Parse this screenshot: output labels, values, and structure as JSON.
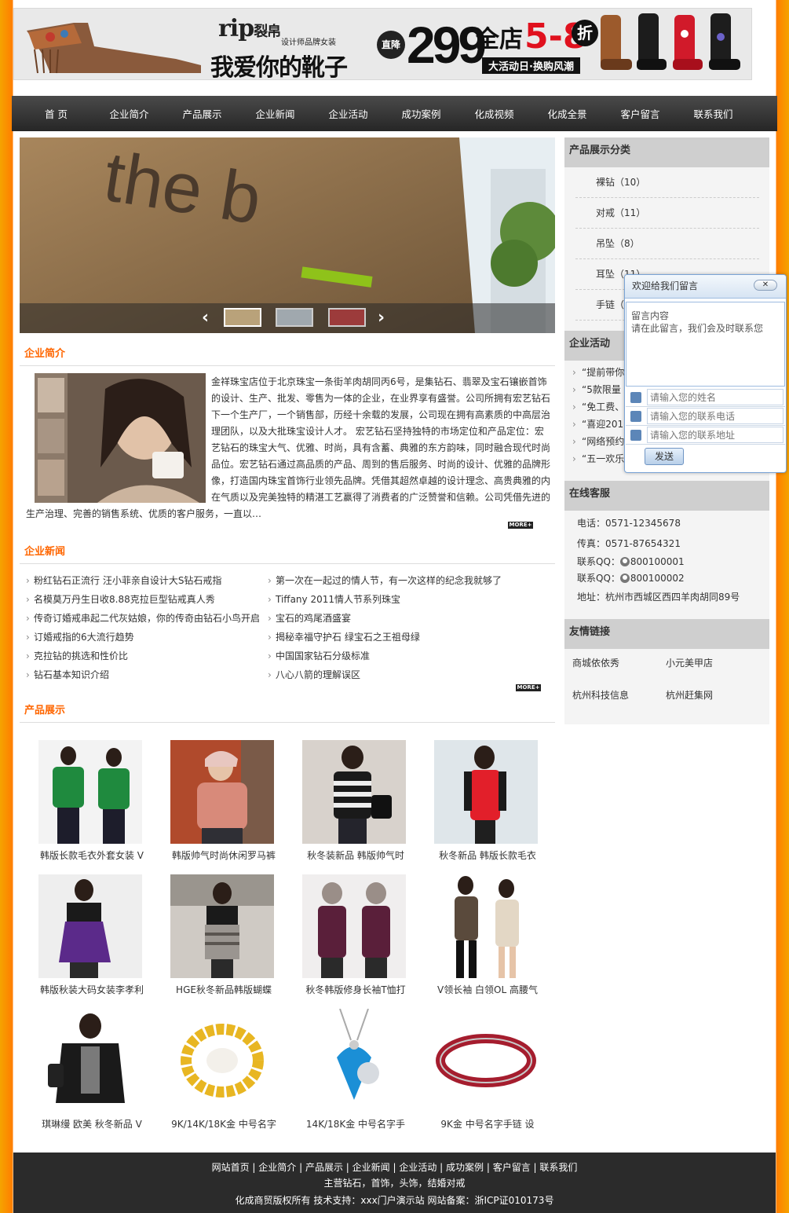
{
  "banner": {
    "logo": "rip",
    "logo_cn": "裂帛",
    "logo_sub": "设计师品牌女装",
    "slogan": "我爱你的靴子",
    "drop": "直降",
    "price": "299",
    "all_store": "全店",
    "sale": "5-8",
    "zhe": "折",
    "tag": "大活动日·换购风潮"
  },
  "nav": [
    "首 页",
    "企业简介",
    "产品展示",
    "企业新闻",
    "企业活动",
    "成功案例",
    "化成视频",
    "化成全景",
    "客户留言",
    "联系我们"
  ],
  "slider": {
    "prev": "‹",
    "next": "›"
  },
  "intro": {
    "title": "企业简介",
    "text": "金祥珠宝店位于北京珠宝一条街羊肉胡同丙6号，是集钻石、翡翠及宝石镶嵌首饰的设计、生产、批发、零售为一体的企业，在业界享有盛誉。公司所拥有宏艺钻石下一个生产厂，一个销售部，历经十余载的发展，公司现在拥有高素质的中高层治理团队，以及大批珠宝设计人才。 宏艺钻石坚持独特的市场定位和产品定位：宏艺钻石的珠宝大气、优雅、时尚，具有含蓄、典雅的东方韵味，同时融合现代时尚品位。宏艺钻石通过高品质的产品、周到的售后服务、时尚的设计、优雅的品牌形像，打造国内珠宝首饰行业领先品牌。凭借其超然卓越的设计理念、高贵典雅的内在气质以及完美独特的精湛工艺赢得了消费者的广泛赞誉和信赖。公司凭借先进的生产治理、完善的销售系统、优质的客户服务，一直以…",
    "more": "MORE+"
  },
  "news": {
    "title": "企业新闻",
    "left": [
      "粉红钻石正流行 汪小菲亲自设计大S钻石戒指",
      "名模莫万丹生日收8.88克拉巨型钻戒真人秀",
      "传奇订婚戒串起二代灰姑娘，你的传奇由钻石小鸟开启",
      "订婚戒指的6大流行趋势",
      "克拉钻的挑选和性价比",
      "钻石基本知识介绍"
    ],
    "right": [
      "第一次在一起过的情人节，有一次这样的纪念我就够了",
      "Tiffany 2011情人节系列珠宝",
      "宝石的鸡尾酒盛宴",
      "揭秘幸福守护石 绿宝石之王祖母绿",
      "中国国家钻石分级标准",
      "八心八箭的理解误区"
    ],
    "more": "MORE+"
  },
  "products": {
    "title": "产品展示",
    "items": [
      "韩版长款毛衣外套女装 V",
      "韩版帅气时尚休闲罗马裤",
      "秋冬装新品 韩版帅气时",
      "秋冬新品 韩版长款毛衣",
      "韩版秋装大码女装李孝利",
      "HGE秋冬新品韩版蝴蝶",
      "秋冬韩版修身长袖T恤打",
      "V领长袖 白领OL 高腰气",
      "琪琳缦 欧美 秋冬新品 V",
      "9K/14K/18K金 中号名字",
      "14K/18K金 中号名字手",
      "9K金 中号名字手链 设"
    ]
  },
  "side": {
    "cat_title": "产品展示分类",
    "cats": [
      "裸钻（10）",
      "对戒（11）",
      "吊坠（8）",
      "耳坠（11）",
      "手链（6）"
    ],
    "act_title": "企业活动",
    "acts": [
      "“提前带你",
      "“5款限量",
      "“免工费、",
      "“喜迎201",
      "“网络预约",
      "“五一欢乐"
    ],
    "svc_title": "在线客服",
    "phone": "电话：0571-12345678",
    "fax": "传真：0571-87654321",
    "qq1_label": "联系QQ：",
    "qq1": "800100001",
    "qq2_label": "联系QQ：",
    "qq2": "800100002",
    "address": "地址：杭州市西城区西四羊肉胡同89号",
    "links_title": "友情链接",
    "links": [
      "商城依依秀",
      "小元美甲店",
      "杭州科技信息",
      "杭州赶集网"
    ]
  },
  "popup": {
    "title": "欢迎给我们留言",
    "close": "✕",
    "body_label": "留言内容",
    "body_hint": "请在此留言，我们会及时联系您",
    "name_placeholder": "请输入您的姓名",
    "phone_placeholder": "请输入您的联系电话",
    "addr_placeholder": "请输入您的联系地址",
    "send": "发送"
  },
  "footer": {
    "links": [
      "网站首页",
      "企业简介",
      "产品展示",
      "企业新闻",
      "企业活动",
      "成功案例",
      "客户留言",
      "联系我们"
    ],
    "line2": "主营钻石，首饰，头饰，结婚对戒",
    "line3": "化成商贸版权所有 技术支持：xxx门户演示站 网站备案：浙ICP证010173号"
  },
  "colors": {
    "accent": "#ff6600",
    "nav_bg": "#333333",
    "side_header": "#cfcfcf",
    "footer_bg": "#2b2b2b"
  }
}
